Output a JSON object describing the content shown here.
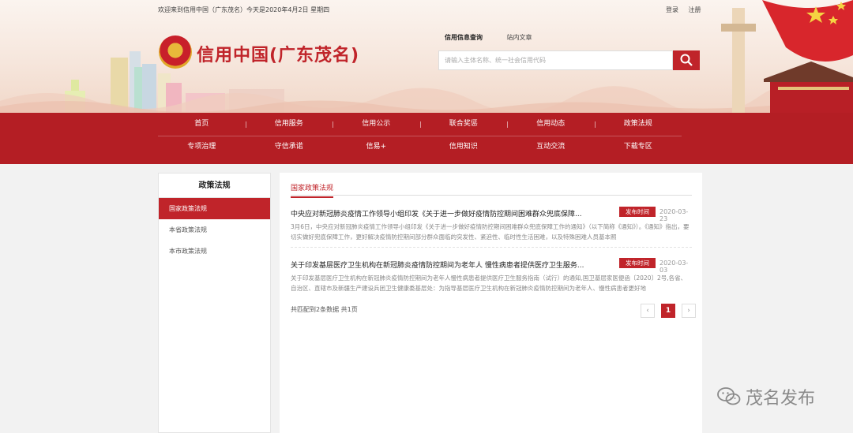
{
  "topbar": {
    "welcome": "欢迎来到信用中国（广东茂名）今天是2020年4月2日 星期四",
    "login": "登录",
    "register": "注册"
  },
  "site": {
    "title": "信用中国(广东茂名)"
  },
  "search": {
    "tabs": [
      "信用信息查询",
      "站内文章"
    ],
    "placeholder": "请输入主体名称、统一社会信用代码"
  },
  "nav": {
    "row1": [
      "首页",
      "信用服务",
      "信用公示",
      "联合奖惩",
      "信用动态",
      "政策法规"
    ],
    "row2": [
      "专项治理",
      "守信承诺",
      "信易+",
      "信用知识",
      "互动交流",
      "下载专区"
    ]
  },
  "sidebar": {
    "title": "政策法规",
    "items": [
      "国家政策法规",
      "本省政策法规",
      "本市政策法规"
    ]
  },
  "main": {
    "heading": "国家政策法规",
    "articles": [
      {
        "title": "中央应对新冠肺炎疫情工作领导小组印发《关于进一步做好疫情防控期间困难群众兜底保障...",
        "badge": "发布时间",
        "date": "2020-03-23",
        "summary": "3月6日，中央应对新冠肺炎疫情工作领导小组印发《关于进一步做好疫情防控期间困难群众兜底保障工作的通知》（以下简称《通知》）。《通知》指出，要切实做好兜底保障工作，更好解决疫情防控期间部分群众面临的突发性、紧迫性、临时性生活困难，以及特殊困难人员基本照"
      },
      {
        "title": "关于印发基层医疗卫生机构在新冠肺炎疫情防控期间为老年人 慢性病患者提供医疗卫生服务...",
        "badge": "发布时间",
        "date": "2020-03-03",
        "summary": "关于印发基层医疗卫生机构在新冠肺炎疫情防控期间为老年人慢性病患者提供医疗卫生服务指南（试行）的通知,国卫基层家医便函〔2020〕2号,各省、自治区、直辖市及新疆生产建设兵团卫生健康委基层处：为指导基层医疗卫生机构在新冠肺炎疫情防控期间为老年人、慢性病患者更好地"
      }
    ],
    "footer": "共匹配到2条数据  共1页",
    "pager": {
      "prev": "‹",
      "current": "1",
      "next": "›"
    }
  },
  "watermark": {
    "text": "茂名发布",
    "icon": "wechat-icon"
  },
  "colors": {
    "brand_red": "#c0242a",
    "nav_red": "#b41e24"
  }
}
